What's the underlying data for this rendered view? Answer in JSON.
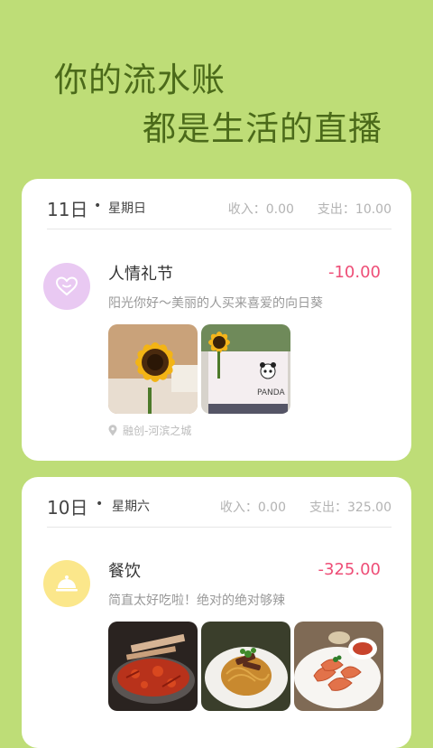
{
  "headline": {
    "line1": "你的流水账",
    "line2": "都是生活的直播"
  },
  "days": [
    {
      "day": "11日",
      "dot": "•",
      "weekday": "星期日",
      "income_label": "收入：",
      "income": "0.00",
      "expense_label": "支出：",
      "expense": "10.00",
      "entry": {
        "icon": "heart-icon",
        "title": "人情礼节",
        "amount": "-10.00",
        "note": "阳光你好～美丽的人买来喜爱的向日葵",
        "location": "融创-河滨之城",
        "photos": [
          "sunflower-photo",
          "sunflower-panda-photo"
        ]
      }
    },
    {
      "day": "10日",
      "dot": "•",
      "weekday": "星期六",
      "income_label": "收入：",
      "income": "0.00",
      "expense_label": "支出：",
      "expense": "325.00",
      "entry": {
        "icon": "food-cloche-icon",
        "title": "餐饮",
        "amount": "-325.00",
        "note": "简直太好吃啦！绝对的绝对够辣",
        "photos": [
          "hotpot-photo",
          "pasta-photo",
          "shrimp-photo"
        ]
      }
    }
  ],
  "colors": {
    "background": "#bedd77",
    "headline": "#4b6a1a",
    "amount": "#ee4e77",
    "heart_bg": "#e9c9f2",
    "cloche_bg": "#fbe78b"
  }
}
